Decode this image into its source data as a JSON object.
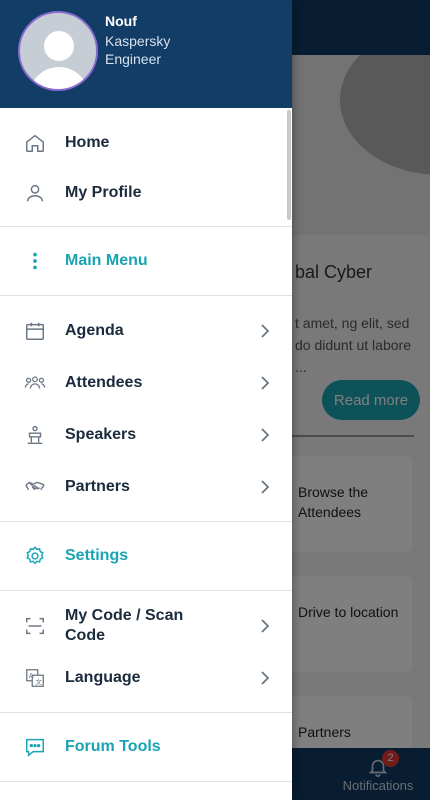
{
  "background": {
    "article_title": "bal Cyber",
    "article_text": "t amet, ng elit, sed do didunt ut labore ...",
    "read_more_label": "Read more",
    "tiles": [
      {
        "label": "Browse the Attendees"
      },
      {
        "label": "Drive to location"
      },
      {
        "label": "Partners"
      }
    ],
    "notifications_label": "Notifications",
    "notifications_count": "2"
  },
  "drawer": {
    "user": {
      "name": "Nouf",
      "company": "Kaspersky",
      "role": "Engineer"
    },
    "items": [
      {
        "label": "Home",
        "icon": "home-icon"
      },
      {
        "label": "My Profile",
        "icon": "user-icon"
      },
      {
        "label": "Main Menu",
        "icon": "dots-vertical-icon"
      },
      {
        "label": "Agenda",
        "icon": "calendar-icon"
      },
      {
        "label": "Attendees",
        "icon": "people-icon"
      },
      {
        "label": "Speakers",
        "icon": "podium-icon"
      },
      {
        "label": "Partners",
        "icon": "handshake-icon"
      },
      {
        "label": "Settings",
        "icon": "gear-icon"
      },
      {
        "label": "My Code / Scan Code",
        "icon": "scan-icon"
      },
      {
        "label": "Language",
        "icon": "translate-icon"
      },
      {
        "label": "Forum Tools",
        "icon": "chat-icon"
      }
    ]
  },
  "colors": {
    "header": "#123d66",
    "accent": "#1aa3b3",
    "text": "#1b2b3d"
  }
}
